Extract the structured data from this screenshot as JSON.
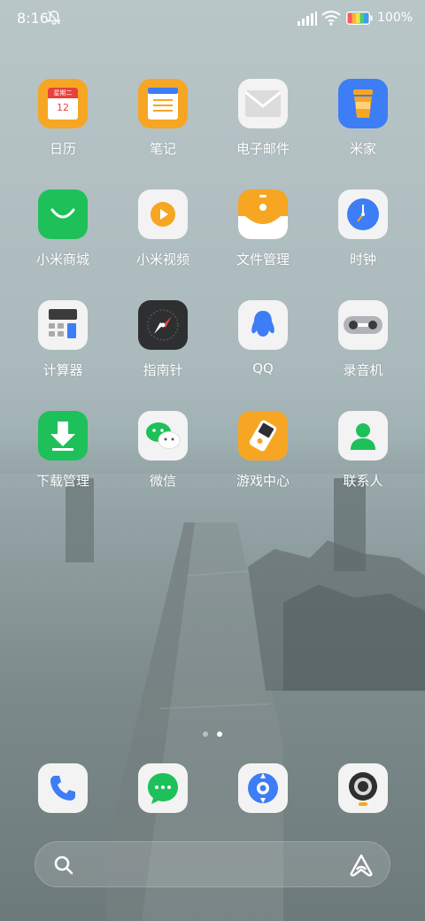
{
  "status_bar": {
    "time": "8:16",
    "battery_percent": "100%",
    "icons": [
      "bell-off-icon",
      "signal-icon",
      "wifi-icon",
      "battery-icon"
    ]
  },
  "calendar_icon": {
    "weekday": "星期二",
    "day": "12"
  },
  "apps": [
    {
      "label": "日历",
      "icon": "calendar-icon"
    },
    {
      "label": "笔记",
      "icon": "notes-icon"
    },
    {
      "label": "电子邮件",
      "icon": "mail-icon"
    },
    {
      "label": "米家",
      "icon": "mijia-icon"
    },
    {
      "label": "小米商城",
      "icon": "mi-store-icon"
    },
    {
      "label": "小米视频",
      "icon": "mi-video-icon"
    },
    {
      "label": "文件管理",
      "icon": "file-manager-icon"
    },
    {
      "label": "时钟",
      "icon": "clock-icon"
    },
    {
      "label": "计算器",
      "icon": "calculator-icon"
    },
    {
      "label": "指南针",
      "icon": "compass-icon"
    },
    {
      "label": "QQ",
      "icon": "qq-icon"
    },
    {
      "label": "录音机",
      "icon": "recorder-icon"
    },
    {
      "label": "下载管理",
      "icon": "download-manager-icon"
    },
    {
      "label": "微信",
      "icon": "wechat-icon"
    },
    {
      "label": "游戏中心",
      "icon": "game-center-icon"
    },
    {
      "label": "联系人",
      "icon": "contacts-icon"
    }
  ],
  "page_indicator": {
    "pages": 2,
    "current": 2
  },
  "dock": [
    "phone-icon",
    "messages-icon",
    "browser-icon",
    "camera-icon"
  ],
  "search_bar": {
    "icons": [
      "search-icon",
      "xiaoai-icon"
    ]
  },
  "colors": {
    "orange": "#f6a623",
    "green": "#1ec05a",
    "blue": "#3d7df5",
    "white_icon_bg": "#f3f3f3"
  }
}
